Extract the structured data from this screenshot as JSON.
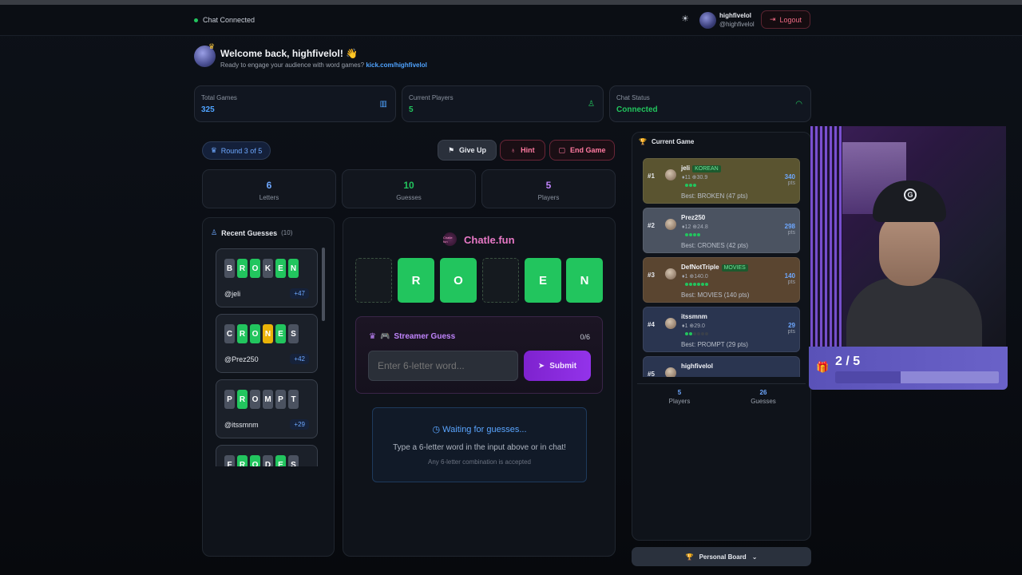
{
  "header": {
    "chat_status": "Chat Connected",
    "username": "highfivelol",
    "handle": "@highfivelol",
    "logout_label": "Logout"
  },
  "welcome": {
    "title": "Welcome back, highfivelol! 👋",
    "subtitle": "Ready to engage your audience with word games?",
    "link": "kick.com/highfivelol"
  },
  "stats": [
    {
      "label": "Total Games",
      "value": "325",
      "color": "#4fa3ff",
      "icon": "bar-chart-icon"
    },
    {
      "label": "Current Players",
      "value": "5",
      "color": "#22c55e",
      "icon": "user-icon"
    },
    {
      "label": "Chat Status",
      "value": "Connected",
      "color": "#22c55e",
      "icon": "wifi-icon"
    }
  ],
  "game": {
    "round_label": "Round 3 of 5",
    "give_up_label": "Give Up",
    "hint_label": "Hint",
    "end_game_label": "End Game",
    "mini_stats": [
      {
        "value": "6",
        "label": "Letters",
        "color": "#6ea8ff"
      },
      {
        "value": "10",
        "label": "Guesses",
        "color": "#22c55e"
      },
      {
        "value": "5",
        "label": "Players",
        "color": "#c084fc"
      }
    ],
    "logo_text": "Chatle.fun",
    "logo_icon_text": "Chatle fun",
    "board": [
      "",
      "R",
      "O",
      "",
      "E",
      "N"
    ],
    "streamer_title": "Streamer Guess",
    "streamer_count": "0/6",
    "input_placeholder": "Enter 6-letter word...",
    "submit_label": "Submit",
    "waiting_title": "Waiting for guesses...",
    "waiting_sub": "Type a 6-letter word in the input above or in chat!",
    "waiting_hint": "Any 6-letter combination is accepted"
  },
  "recent": {
    "title": "Recent Guesses",
    "count": "(10)",
    "items": [
      {
        "letters": [
          "B",
          "R",
          "O",
          "K",
          "E",
          "N"
        ],
        "colors": [
          "x",
          "g",
          "g",
          "x",
          "g",
          "g"
        ],
        "user": "@jeli",
        "pts": "+47"
      },
      {
        "letters": [
          "C",
          "R",
          "O",
          "N",
          "E",
          "S"
        ],
        "colors": [
          "x",
          "g",
          "g",
          "y",
          "g",
          "x"
        ],
        "user": "@Prez250",
        "pts": "+42"
      },
      {
        "letters": [
          "P",
          "R",
          "O",
          "M",
          "P",
          "T"
        ],
        "colors": [
          "x",
          "g",
          "x",
          "x",
          "x",
          "x"
        ],
        "user": "@itssmnm",
        "pts": "+29"
      },
      {
        "letters": [
          "F",
          "R",
          "O",
          "D",
          "E",
          "S"
        ],
        "colors": [
          "x",
          "g",
          "g",
          "x",
          "g",
          "x"
        ],
        "user": "",
        "pts": ""
      }
    ]
  },
  "current_game": {
    "title": "Current Game",
    "rows": [
      {
        "rank": "#1",
        "name": "jeli",
        "tag": "KOREAN",
        "meta": "♦11 ⊕30.9",
        "pts": "340",
        "best": "Best: BROKEN (47 pts)",
        "dots": [
          1,
          1,
          1
        ],
        "bg": "#5a5430"
      },
      {
        "rank": "#2",
        "name": "Prez250",
        "tag": "",
        "meta": "♦12 ⊕24.8",
        "pts": "298",
        "best": "Best: CRONES (42 pts)",
        "dots": [
          1,
          1,
          1,
          1
        ],
        "bg": "#4b5361"
      },
      {
        "rank": "#3",
        "name": "DefNotTriple",
        "tag": "MOVIES",
        "meta": "♦1 ⊕140.0",
        "pts": "140",
        "best": "Best: MOVIES (140 pts)",
        "dots": [
          1,
          1,
          1,
          1,
          1,
          1
        ],
        "bg": "#5a4530"
      },
      {
        "rank": "#4",
        "name": "itssmnm",
        "tag": "",
        "meta": "♦1 ⊕29.0",
        "pts": "29",
        "best": "Best: PROMPT (29 pts)",
        "dots": [
          1,
          1,
          0,
          0,
          0,
          0
        ],
        "bg": "#2a3550"
      },
      {
        "rank": "#5",
        "name": "highfivelol",
        "tag": "",
        "meta": "",
        "pts": "",
        "best": "",
        "dots": [],
        "bg": "#2a3550"
      }
    ],
    "footer": [
      {
        "value": "5",
        "label": "Players"
      },
      {
        "value": "26",
        "label": "Guesses"
      }
    ],
    "personal_board_label": "Personal Board"
  },
  "overlay": {
    "progress_text": "2 / 5",
    "progress_fraction": 0.4
  }
}
